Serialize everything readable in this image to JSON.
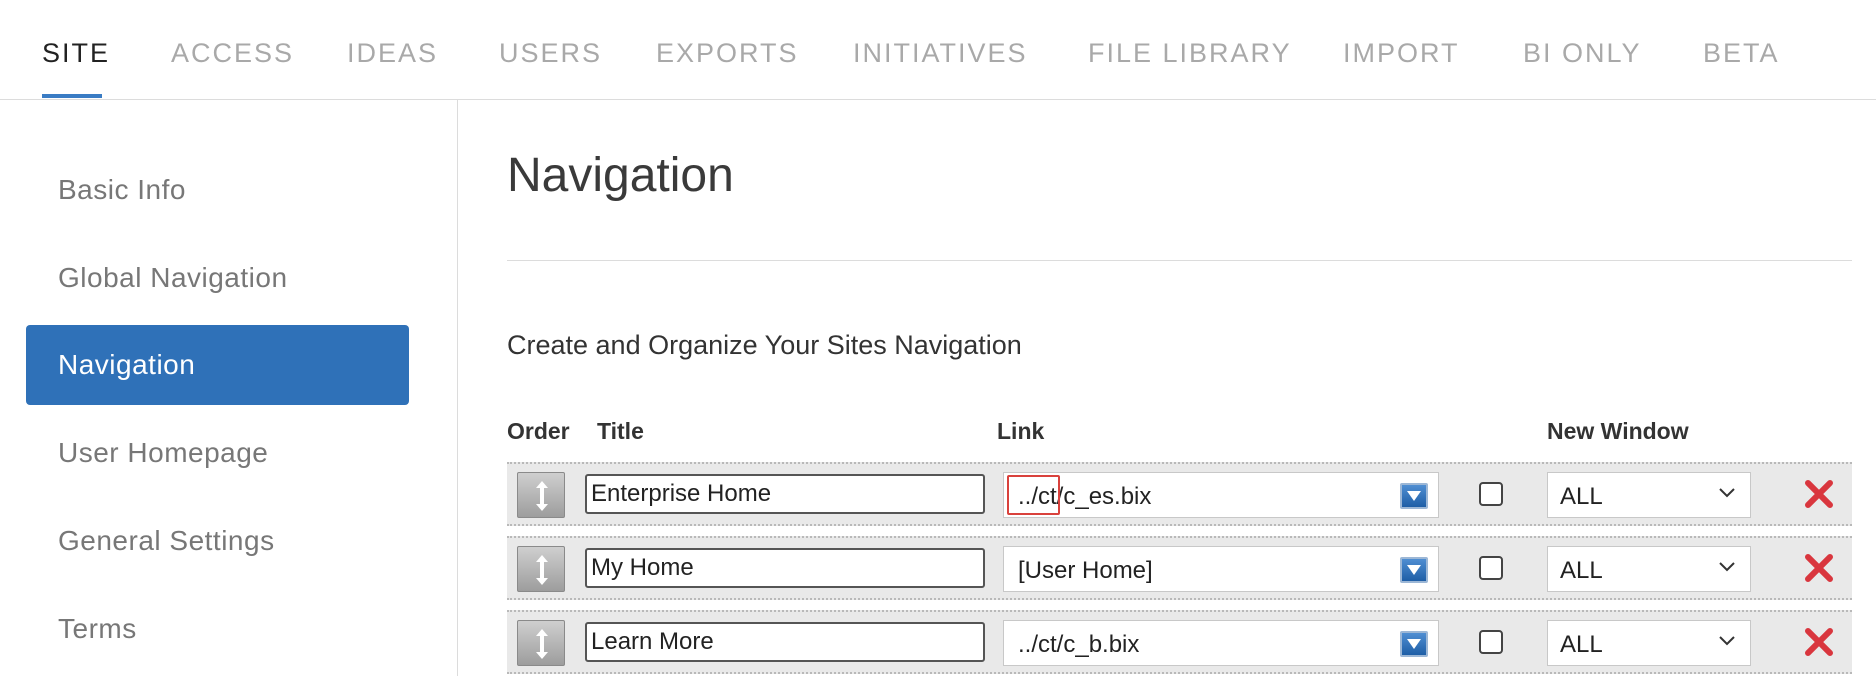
{
  "topnav": {
    "tabs": [
      {
        "label": "SITE",
        "active": true
      },
      {
        "label": "ACCESS"
      },
      {
        "label": "IDEAS"
      },
      {
        "label": "USERS"
      },
      {
        "label": "EXPORTS"
      },
      {
        "label": "INITIATIVES"
      },
      {
        "label": "FILE LIBRARY"
      },
      {
        "label": "IMPORT"
      },
      {
        "label": "BI ONLY"
      },
      {
        "label": "BETA"
      }
    ]
  },
  "sidebar": {
    "items": [
      {
        "label": "Basic Info"
      },
      {
        "label": "Global Navigation"
      },
      {
        "label": "Navigation",
        "active": true
      },
      {
        "label": "User Homepage"
      },
      {
        "label": "General Settings"
      },
      {
        "label": "Terms"
      }
    ]
  },
  "main": {
    "title": "Navigation",
    "subtitle": "Create and Organize Your Sites Navigation",
    "columns": {
      "order": "Order",
      "title": "Title",
      "link": "Link",
      "new_window": "New Window"
    },
    "rows": [
      {
        "title": "Enterprise Home",
        "link": "../ct/c_es.bix",
        "new_window": false,
        "audience": "ALL"
      },
      {
        "title": "My Home",
        "link": "[User Home]",
        "new_window": false,
        "audience": "ALL"
      },
      {
        "title": "Learn More",
        "link": "../ct/c_b.bix",
        "new_window": false,
        "audience": "ALL"
      }
    ]
  },
  "colors": {
    "accent": "#2f71b8",
    "delete": "#d9363e",
    "highlight": "#d9413c"
  },
  "icons": {
    "order_handle": "drag-handle-icon",
    "link_dropdown": "dropdown-arrow-icon",
    "select": "chevron-down-icon",
    "delete": "close-x-icon"
  }
}
